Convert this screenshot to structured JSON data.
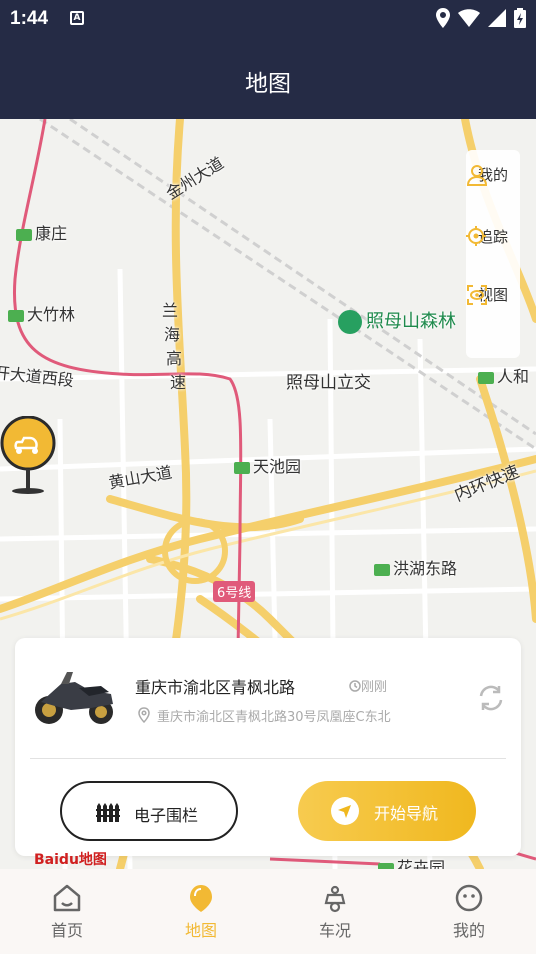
{
  "status": {
    "time": "1:44",
    "a_icon": "A"
  },
  "header": {
    "title": "地图"
  },
  "map": {
    "labels": {
      "jinzhou": "金州大道",
      "kangzhuang": "康庄",
      "dazhulin": "大竹林",
      "lanhai_1": "兰",
      "lanhai_2": "海",
      "lanhai_3": "高",
      "lanhai_4": "速",
      "zhaomu_park": "照母山森林",
      "kaidao": "开大道西段",
      "zhaomu_jiao": "照母山立交",
      "renhe": "人和",
      "huangshan": "黄山大道",
      "tianyuan": "天池园",
      "neihuan": "内环快速",
      "honghu": "洪湖东路",
      "line6": "6号线",
      "huasiyuan": "花卉园",
      "baidu": "Baidu地图"
    },
    "colors": {
      "road_major": "#f5cf6b",
      "metro_line": "#e05a7a",
      "accent": "#f2b934"
    }
  },
  "side_panel": {
    "items": [
      {
        "label": "我的",
        "icon": "person-icon"
      },
      {
        "label": "追踪",
        "icon": "target-icon"
      },
      {
        "label": "视图",
        "icon": "view-icon"
      }
    ]
  },
  "card": {
    "title": "重庆市渝北区青枫北路",
    "time": "刚刚",
    "address": "重庆市渝北区青枫北路30号凤凰座C东北",
    "fence_label": "电子围栏",
    "nav_label": "开始导航"
  },
  "tabs": [
    {
      "label": "首页",
      "icon": "home-icon"
    },
    {
      "label": "地图",
      "icon": "map-icon"
    },
    {
      "label": "车况",
      "icon": "scooter-icon"
    },
    {
      "label": "我的",
      "icon": "profile-icon"
    }
  ],
  "active_tab": "地图"
}
